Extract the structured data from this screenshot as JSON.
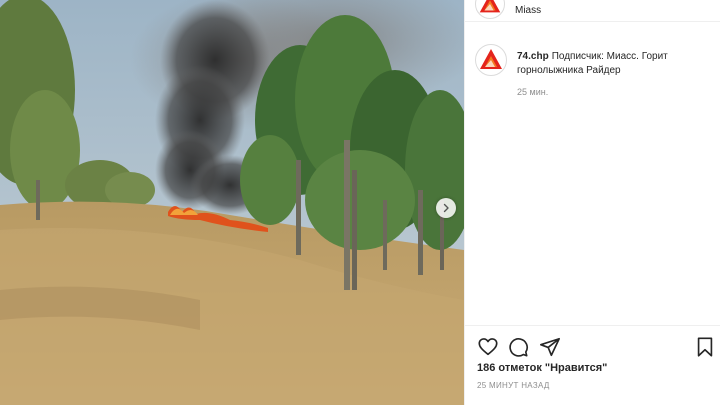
{
  "post": {
    "location": "Miass",
    "next_icon": "chevron-right-icon"
  },
  "caption": {
    "username": "74.chp",
    "text": "Подписчик: Миасс. Горит горнолыжника Райдер",
    "time": "25 мин."
  },
  "actions": {
    "like_icon": "heart-icon",
    "comment_icon": "comment-icon",
    "share_icon": "share-icon",
    "save_icon": "bookmark-icon",
    "likes": "186 отметок \"Нравится\"",
    "posted": "25 МИНУТ НАЗАД"
  },
  "colors": {
    "text": "#262626",
    "secondary": "#8e8e8e",
    "border": "#efefef",
    "avatar_red": "#e4241c",
    "avatar_orange": "#f47b20"
  }
}
